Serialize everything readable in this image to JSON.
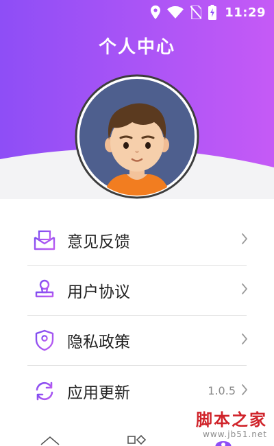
{
  "status_bar": {
    "time": "11:29",
    "icons": [
      "location-icon",
      "wifi-icon",
      "no-sim-icon",
      "battery-charging-icon"
    ]
  },
  "header": {
    "title": "个人中心",
    "gradient": [
      "#8e4ef6",
      "#c55af6"
    ]
  },
  "profile": {
    "avatar_icon": "user-avatar-icon"
  },
  "menu": {
    "items": [
      {
        "label": "意见反馈",
        "icon": "feedback-mail-icon",
        "value": ""
      },
      {
        "label": "用户协议",
        "icon": "user-agreement-stamp-icon",
        "value": ""
      },
      {
        "label": "隐私政策",
        "icon": "privacy-shield-icon",
        "value": ""
      },
      {
        "label": "应用更新",
        "icon": "refresh-update-icon",
        "value": "1.0.5"
      }
    ]
  },
  "bottom_nav": {
    "icons": [
      "home-icon",
      "category-icon",
      "profile-tab-icon"
    ]
  },
  "watermark": {
    "title": "脚本之家",
    "url": "www.jb51.net"
  },
  "colors": {
    "accent": "#8e4ef6",
    "icon_start": "#7b4cf0",
    "icon_end": "#c05cf2"
  }
}
